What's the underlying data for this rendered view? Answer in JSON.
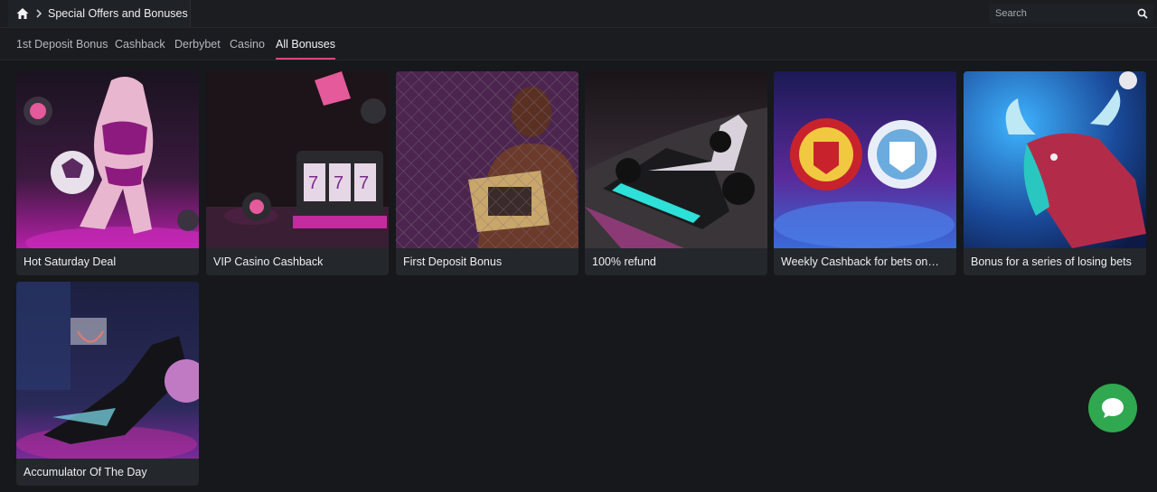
{
  "header": {
    "breadcrumb_title": "Special Offers and Bonuses",
    "search_placeholder": "Search"
  },
  "tabs": [
    {
      "label": "1st Deposit Bonus",
      "active": false
    },
    {
      "label": "Cashback",
      "active": false
    },
    {
      "label": "Derbybet",
      "active": false
    },
    {
      "label": "Casino",
      "active": false
    },
    {
      "label": "All Bonuses",
      "active": true
    }
  ],
  "cards": [
    {
      "title": "Hot Saturday Deal",
      "image": "pink-dancer-with-soccer-ball"
    },
    {
      "title": "VIP Casino Cashback",
      "image": "slot-machine-with-chips"
    },
    {
      "title": "First Deposit Bonus",
      "image": "fighter-with-championship-belt"
    },
    {
      "title": "100% refund",
      "image": "formula-one-car"
    },
    {
      "title": "Weekly Cashback for bets on…",
      "image": "manchester-united-vs-manchester-city-crests"
    },
    {
      "title": "Bonus for a series of losing bets",
      "image": "neon-bull"
    },
    {
      "title": "Accumulator Of The Day",
      "image": "basketball-player-dunking"
    }
  ],
  "colors": {
    "background": "#16181b",
    "card": "#24272b",
    "accent": "#e0467c",
    "chat": "#2fa84f"
  },
  "icons": {
    "home": "home-icon",
    "chevron": "chevron-right-icon",
    "search": "search-icon",
    "chat": "chat-bubble-icon"
  }
}
